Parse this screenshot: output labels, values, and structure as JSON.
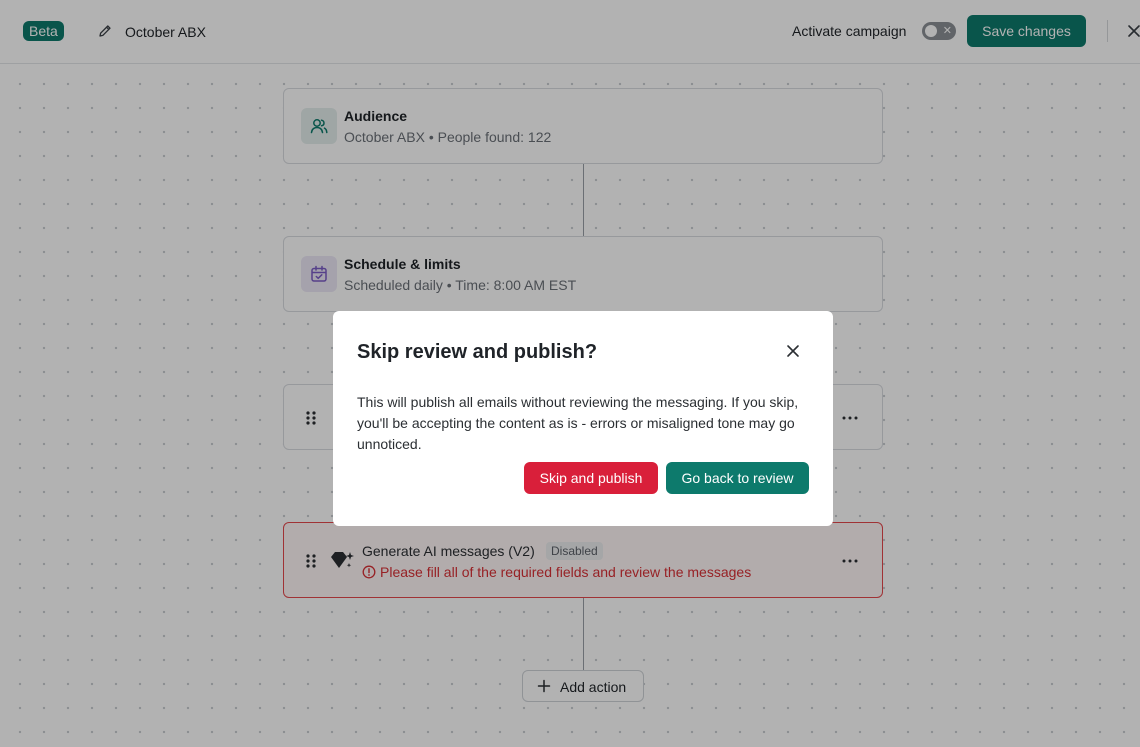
{
  "header": {
    "beta_label": "Beta",
    "campaign_name": "October ABX",
    "activate_label": "Activate campaign",
    "activate_state": "off",
    "save_label": "Save changes"
  },
  "nodes": {
    "audience": {
      "title": "Audience",
      "subtitle": "October ABX • People found: 122",
      "icon": "users-icon"
    },
    "schedule": {
      "title": "Schedule & limits",
      "subtitle": "Scheduled daily • Time: 8:00 AM EST",
      "icon": "calendar-check-icon"
    },
    "generate": {
      "title": "Generate AI messages (V2)",
      "badge": "Disabled",
      "error": "Please fill all of the required fields and review the messages",
      "icon": "sparkle-diamond-icon"
    }
  },
  "add_action_label": "Add action",
  "modal": {
    "title": "Skip review and publish?",
    "body": "This will publish all emails without reviewing the messaging. If you skip, you'll be accepting the content as is - errors or misaligned tone may go unnoticed.",
    "skip_label": "Skip and publish",
    "back_label": "Go back to review"
  },
  "colors": {
    "brand": "#0d7a6c",
    "danger": "#d91f3a",
    "error": "#e5484d"
  }
}
